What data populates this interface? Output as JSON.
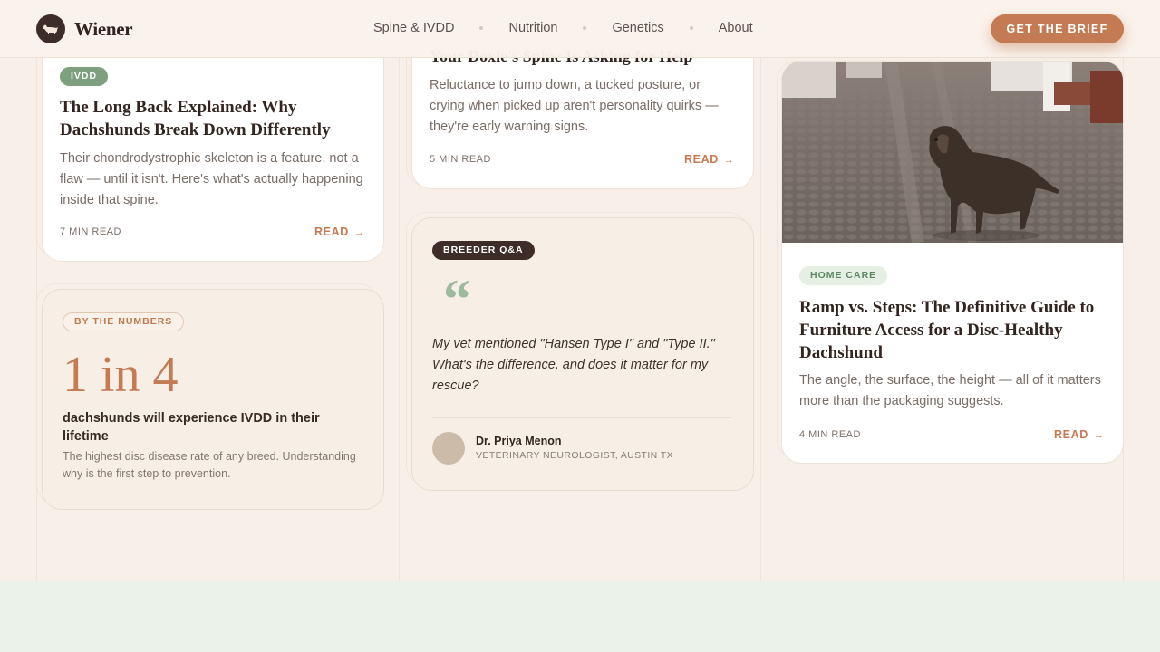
{
  "brand": {
    "name": "Wiener",
    "logo_icon": "dachshund-icon"
  },
  "nav": {
    "items": [
      {
        "label": "Spine & IVDD"
      },
      {
        "label": "Nutrition"
      },
      {
        "label": "Genetics"
      },
      {
        "label": "About"
      }
    ],
    "cta_label": "GET THE BRIEF"
  },
  "cards": {
    "long_back": {
      "tag": "IVDD",
      "title": "The Long Back Explained: Why Dachshunds Break Down Differently",
      "excerpt": "Their chondrodystrophic skeleton is a feature, not a flaw — until it isn't. Here's what's actually happening inside that spine.",
      "read_time": "7 MIN READ",
      "read_label": "READ"
    },
    "spine_help": {
      "title": "Your Doxie's Spine Is Asking for Help",
      "excerpt": "Reluctance to jump down, a tucked posture, or crying when picked up aren't personality quirks — they're early warning signs.",
      "read_time": "5 MIN READ",
      "read_label": "READ"
    },
    "numbers": {
      "tag": "BY THE NUMBERS",
      "stat": "1 in 4",
      "stat_label": "dachshunds will experience IVDD in their lifetime",
      "note": "The highest disc disease rate of any breed. Understanding why is the first step to prevention."
    },
    "qa": {
      "tag": "BREEDER Q&A",
      "quote_mark": "“",
      "quote": "My vet mentioned \"Hansen Type I\" and \"Type II.\" What's the difference, and does it matter for my rescue?",
      "author_name": "Dr. Priya Menon",
      "author_role": "VETERINARY NEUROLOGIST, AUSTIN TX"
    },
    "ramp": {
      "tag": "HOME CARE",
      "title": "Ramp vs. Steps: The Definitive Guide to Furniture Access for a Disc-Healthy Dachshund",
      "excerpt": "The angle, the surface, the height — all of it matters more than the packaging suggests.",
      "read_time": "4 MIN READ",
      "read_label": "READ"
    }
  },
  "colors": {
    "accent": "#c47a52",
    "dark": "#3d2c27",
    "sage": "#7ea07f",
    "background": "#f8f0e8"
  }
}
